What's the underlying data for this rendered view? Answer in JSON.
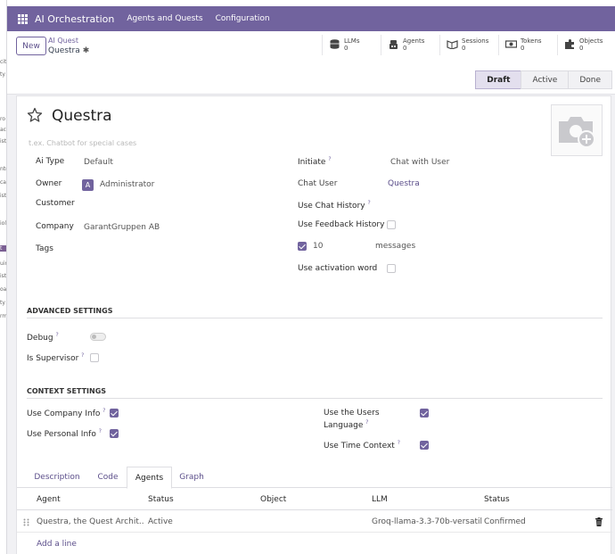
{
  "left_strip": [
    "cit",
    "ty",
    "ro",
    "ac",
    "ist",
    "ntr",
    "cas",
    "ist",
    "iol",
    "t",
    "uir",
    "ist",
    "oa",
    "ty",
    "rm"
  ],
  "topbar": {
    "app_name": "AI Orchestration",
    "menu": [
      "Agents and Quests",
      "Configuration"
    ]
  },
  "control_panel": {
    "new_label": "New",
    "breadcrumb_parent": "AI Quest",
    "breadcrumb_current": "Questra",
    "stats": [
      {
        "label": "LLMs",
        "value": "0",
        "icon": "database-icon"
      },
      {
        "label": "Agents",
        "value": "0",
        "icon": "agent-icon"
      },
      {
        "label": "Sessions",
        "value": "0",
        "icon": "sessions-icon"
      },
      {
        "label": "Tokens",
        "value": "0",
        "icon": "money-icon"
      },
      {
        "label": "Objects",
        "value": "0",
        "icon": "puzzle-icon"
      }
    ],
    "stages": [
      {
        "label": "Draft",
        "active": true
      },
      {
        "label": "Active",
        "active": false
      },
      {
        "label": "Done",
        "active": false
      }
    ]
  },
  "form": {
    "title": "Questra",
    "subtitle_placeholder": "t.ex. Chatbot for special cases",
    "left_fields": {
      "ai_type_label": "Ai Type",
      "ai_type_value": "Default",
      "owner_label": "Owner",
      "owner_avatar": "A",
      "owner_value": "Administrator",
      "customer_label": "Customer",
      "company_label": "Company",
      "company_value": "GarantGruppen AB",
      "tags_label": "Tags"
    },
    "right_fields": {
      "initiate_label": "Initiate",
      "initiate_value": "Chat with User",
      "chat_user_label": "Chat User",
      "chat_user_value": "Questra",
      "use_chat_history_label": "Use Chat History",
      "use_feedback_history_label": "Use Feedback History",
      "history_count": "10",
      "history_unit": "messages",
      "use_activation_word_label": "Use activation word"
    },
    "advanced": {
      "heading": "ADVANCED SETTINGS",
      "debug_label": "Debug",
      "is_supervisor_label": "Is Supervisor"
    },
    "context": {
      "heading": "CONTEXT SETTINGS",
      "use_company_info_label": "Use Company Info",
      "use_personal_info_label": "Use Personal Info",
      "use_users_language_label_1": "Use the Users",
      "use_users_language_label_2": "Language",
      "use_time_context_label": "Use Time Context"
    },
    "help_mark": "?"
  },
  "notebook": {
    "tabs": [
      {
        "label": "Description",
        "active": false
      },
      {
        "label": "Code",
        "active": false
      },
      {
        "label": "Agents",
        "active": true
      },
      {
        "label": "Graph",
        "active": false
      }
    ],
    "columns": [
      "Agent",
      "Status",
      "Object",
      "LLM",
      "Status"
    ],
    "rows": [
      {
        "agent": "Questra, the Quest Archit...",
        "status": "Active",
        "object": "",
        "llm": "Groq-llama-3.3-70b-versatile",
        "status2": "Confirmed"
      }
    ],
    "add_line": "Add a line"
  },
  "colors": {
    "brand": "#71639e",
    "link": "#5b4e8a"
  }
}
